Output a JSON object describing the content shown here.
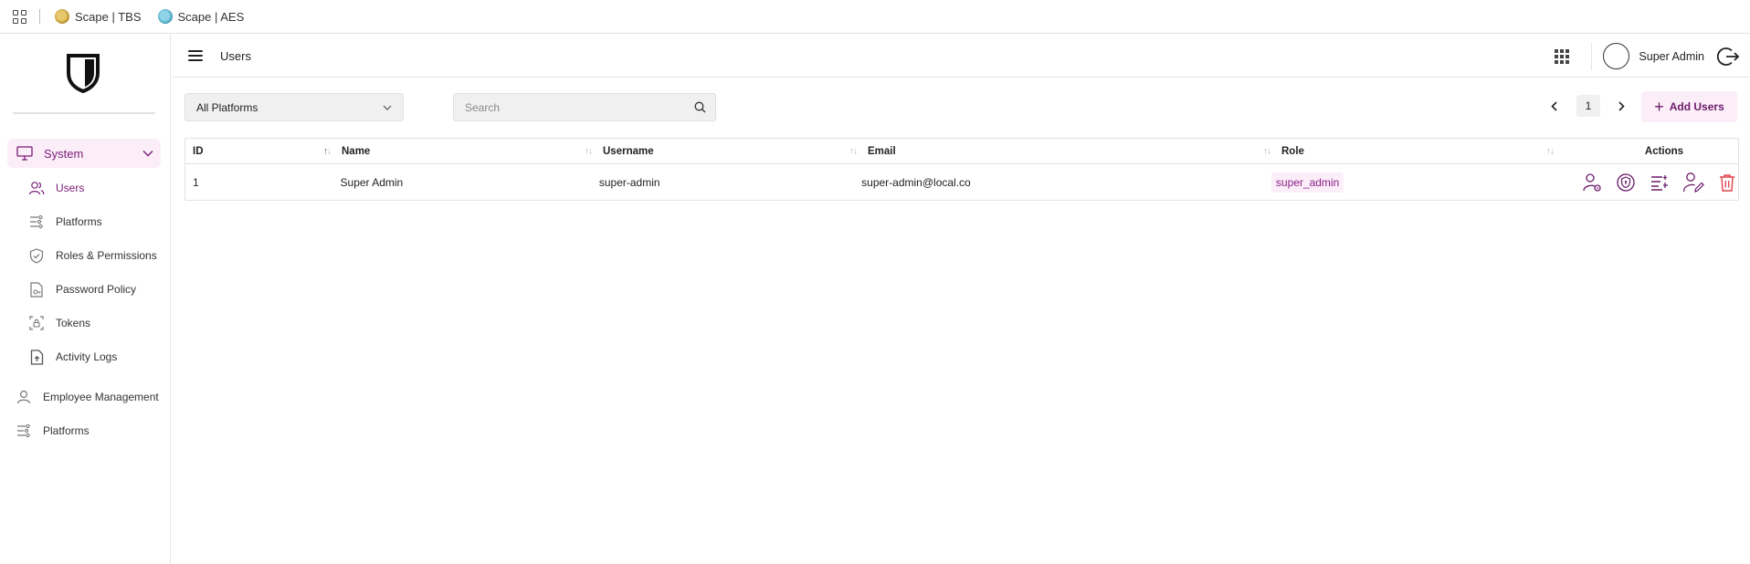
{
  "bookmarks": {
    "items": [
      {
        "label": "Scape | TBS",
        "icon": "scape-tbs-favicon"
      },
      {
        "label": "Scape | AES",
        "icon": "scape-aes-favicon"
      }
    ]
  },
  "header": {
    "title": "Users",
    "user_name": "Super Admin"
  },
  "sidebar": {
    "system_label": "System",
    "sub_items": [
      {
        "label": "Users",
        "icon": "users-icon",
        "active": true
      },
      {
        "label": "Platforms",
        "icon": "list-settings-icon"
      },
      {
        "label": "Roles & Permissions",
        "icon": "shield-check-icon"
      },
      {
        "label": "Password Policy",
        "icon": "document-key-icon"
      },
      {
        "label": "Tokens",
        "icon": "scan-lock-icon"
      },
      {
        "label": "Activity Logs",
        "icon": "file-upload-icon"
      }
    ],
    "top_items": [
      {
        "label": "Employee Management",
        "icon": "person-icon"
      },
      {
        "label": "Platforms",
        "icon": "list-settings-icon"
      }
    ]
  },
  "toolbar": {
    "platform_filter": "All Platforms",
    "search_placeholder": "Search",
    "page": "1",
    "add_label": "Add Users"
  },
  "table": {
    "columns": [
      "ID",
      "Name",
      "Username",
      "Email",
      "Role",
      "Actions"
    ],
    "rows": [
      {
        "id": "1",
        "name": "Super Admin",
        "username": "super-admin",
        "email": "super-admin@local.co",
        "role": "super_admin"
      }
    ]
  },
  "colors": {
    "accent": "#7a1c78",
    "accent_bg": "#fbeef8",
    "danger": "#e0404a"
  }
}
